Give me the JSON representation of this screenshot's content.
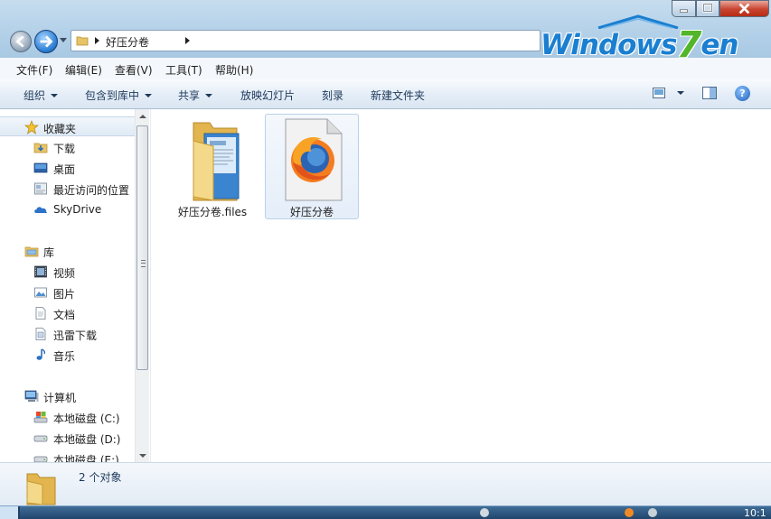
{
  "titlebar": {
    "address_path": "好压分卷",
    "logo_text_pre": "Windows",
    "logo_seven": "7",
    "logo_text_post": "en"
  },
  "menu": {
    "items": [
      "文件(F)",
      "编辑(E)",
      "查看(V)",
      "工具(T)",
      "帮助(H)"
    ]
  },
  "commands": {
    "organize": "组织",
    "include_in_library": "包含到库中",
    "share": "共享",
    "slideshow": "放映幻灯片",
    "burn": "刻录",
    "new_folder": "新建文件夹",
    "help": "?"
  },
  "navpane": {
    "favorites": "收藏夹",
    "downloads": "下载",
    "desktop": "桌面",
    "recent": "最近访问的位置",
    "skydrive": "SkyDrive",
    "libraries": "库",
    "videos": "视频",
    "pictures": "图片",
    "documents": "文档",
    "xunlei": "迅雷下载",
    "music": "音乐",
    "computer": "计算机",
    "drive_c": "本地磁盘 (C:)",
    "drive_d": "本地磁盘 (D:)",
    "drive_e": "本地磁盘 (E:)"
  },
  "files": [
    {
      "name": "好压分卷.files",
      "type": "folder",
      "selected": false
    },
    {
      "name": "好压分卷",
      "type": "firefox-html",
      "selected": true
    }
  ],
  "details": {
    "count_text": "2 个对象"
  },
  "taskbar": {
    "clock": "10:1"
  },
  "colors": {
    "accent": "#1a7fd0",
    "logo_green": "#52b52a",
    "close_button": "#c7432f"
  }
}
